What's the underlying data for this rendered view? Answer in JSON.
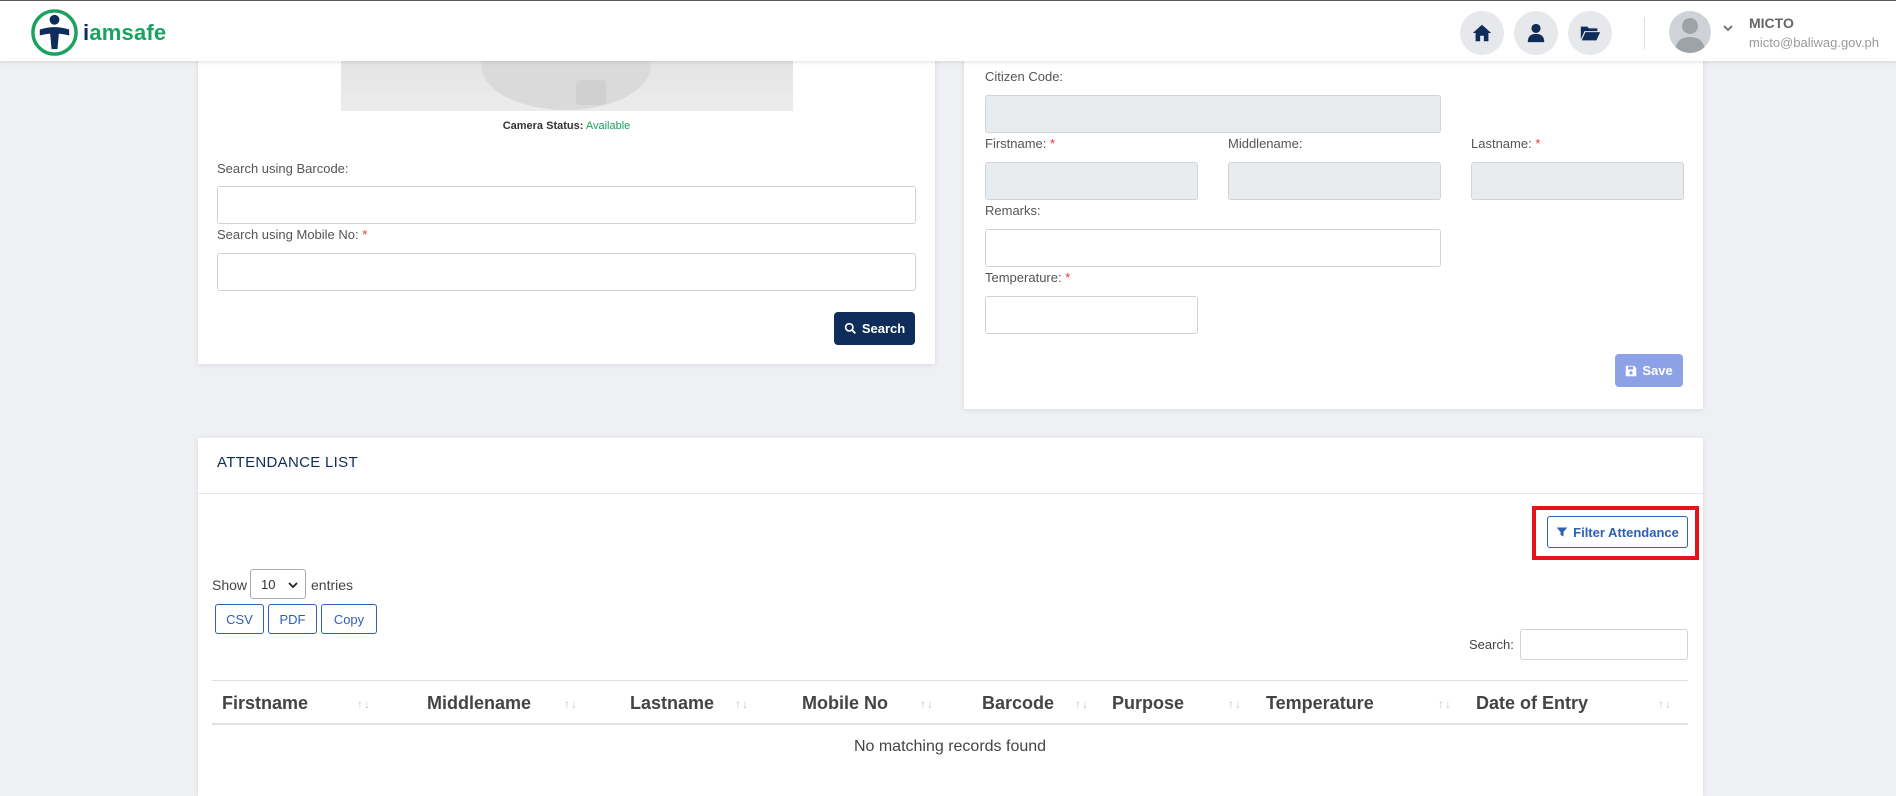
{
  "header": {
    "brand_prefix": "i",
    "brand_mid": "am",
    "brand_suffix": "safe",
    "nav": [
      {
        "name": "home-icon"
      },
      {
        "name": "user-icon"
      },
      {
        "name": "folder-open-icon"
      }
    ],
    "user_name": "MICTO",
    "user_email": "micto@baliwag.gov.ph"
  },
  "search_card": {
    "camera_status_label": "Camera Status:",
    "camera_status_value": "Available",
    "barcode_label": "Search using Barcode:",
    "mobile_label": "Search using Mobile No:",
    "required_mark": "*",
    "barcode_value": "",
    "mobile_value": "",
    "search_button": "Search"
  },
  "citizen_card": {
    "citizen_code_label": "Citizen Code:",
    "firstname_label": "Firstname:",
    "middlename_label": "Middlename:",
    "lastname_label": "Lastname:",
    "remarks_label": "Remarks:",
    "temperature_label": "Temperature:",
    "required_mark": "*",
    "save_button": "Save"
  },
  "attendance": {
    "title": "ATTENDANCE LIST",
    "filter_button": "Filter Attendance",
    "show_label": "Show",
    "entries_label": "entries",
    "page_size": "10",
    "export_buttons": [
      "CSV",
      "PDF",
      "Copy"
    ],
    "search_label": "Search:",
    "search_value": "",
    "columns": [
      "Firstname",
      "Middlename",
      "Lastname",
      "Mobile No",
      "Barcode",
      "Purpose",
      "Temperature",
      "Date of Entry"
    ],
    "sort_glyph": "↑↓",
    "empty_message": "No matching records found"
  },
  "colors": {
    "brand_navy": "#0f2d5a",
    "brand_green": "#1aa260",
    "highlight_red": "#e3141c",
    "save_disabled": "#8da2e6"
  }
}
